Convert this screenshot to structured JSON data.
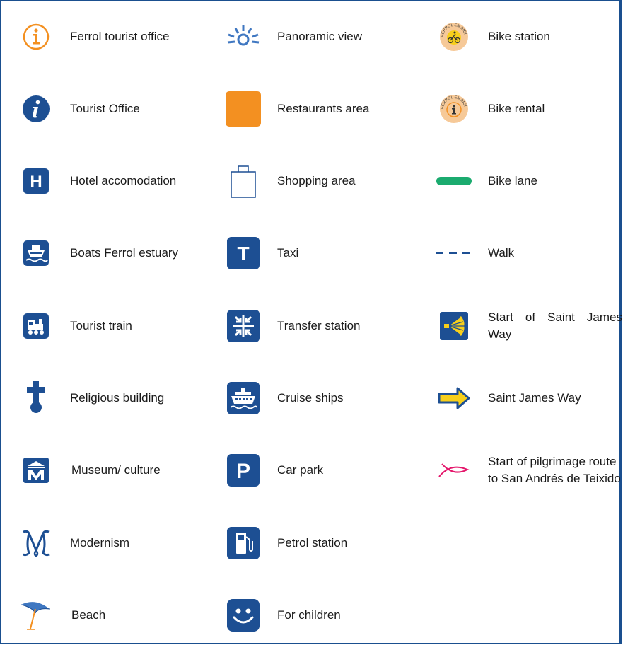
{
  "colors": {
    "brand_blue": "#1d4f93",
    "orange": "#f39021",
    "green": "#1bab6f",
    "yellow": "#f7cf1b",
    "magenta": "#e4166b",
    "peach": "#f6c998"
  },
  "legend": {
    "col1": [
      {
        "icon": "info-outline-icon",
        "label": "Ferrol tourist office"
      },
      {
        "icon": "info-filled-icon",
        "label": "Tourist Office"
      },
      {
        "icon": "hotel-icon",
        "label": "Hotel accomodation"
      },
      {
        "icon": "boat-icon",
        "label": "Boats Ferrol estuary"
      },
      {
        "icon": "train-icon",
        "label": "Tourist train"
      },
      {
        "icon": "cross-icon",
        "label": "Religious building"
      },
      {
        "icon": "museum-icon",
        "label": "Museum/ culture"
      },
      {
        "icon": "modernism-icon",
        "label": "Modernism"
      },
      {
        "icon": "beach-umbrella-icon",
        "label": "Beach"
      }
    ],
    "col2": [
      {
        "icon": "panoramic-view-icon",
        "label": "Panoramic view"
      },
      {
        "icon": "restaurant-square-icon",
        "label": "Restaurants area"
      },
      {
        "icon": "shopping-bag-icon",
        "label": "Shopping area"
      },
      {
        "icon": "taxi-icon",
        "label": "Taxi"
      },
      {
        "icon": "transfer-icon",
        "label": "Transfer station"
      },
      {
        "icon": "cruise-ship-icon",
        "label": "Cruise ships"
      },
      {
        "icon": "parking-icon",
        "label": "Car park"
      },
      {
        "icon": "petrol-icon",
        "label": "Petrol station"
      },
      {
        "icon": "smiley-icon",
        "label": "For children"
      }
    ],
    "col3": [
      {
        "icon": "bike-station-icon",
        "label": "Bike station",
        "badge_text": "FERROL EN BICI"
      },
      {
        "icon": "bike-rental-icon",
        "label": "Bike rental",
        "badge_text": "FERROL EN BICI"
      },
      {
        "icon": "bike-lane-icon",
        "label": "Bike lane"
      },
      {
        "icon": "walk-dashes-icon",
        "label": "Walk"
      },
      {
        "icon": "scallop-shell-icon",
        "label": "Start of  Saint  James Way"
      },
      {
        "icon": "yellow-arrow-icon",
        "label": "Saint James Way"
      },
      {
        "icon": "fish-icon",
        "label": "Start of pilgrimage route to San Andrés de Teixido"
      }
    ]
  }
}
